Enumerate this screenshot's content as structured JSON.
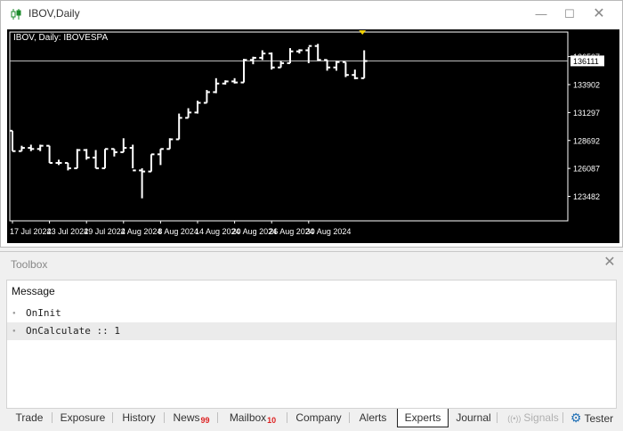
{
  "window": {
    "title": "IBOV,Daily",
    "minimize_glyph": "—",
    "maximize_glyph": "☐",
    "close_glyph": "✕"
  },
  "chart_data": {
    "type": "ohlc",
    "symbol_label": "IBOV, Daily: IBOVESPA",
    "current_price": 136111,
    "current_price_label": "136111",
    "y_tick_labels": [
      "136507",
      "133902",
      "131297",
      "128692",
      "126087",
      "123482"
    ],
    "y_ticks": [
      136507,
      133902,
      131297,
      128692,
      126087,
      123482
    ],
    "ylim": [
      121200,
      138800
    ],
    "x_tick_labels": [
      "17 Jul 2024",
      "23 Jul 2024",
      "29 Jul 2024",
      "2 Aug 2024",
      "8 Aug 2024",
      "14 Aug 2024",
      "20 Aug 2024",
      "26 Aug 2024",
      "30 Aug 2024"
    ],
    "x_tick_bar_index": [
      0,
      4,
      8,
      12,
      16,
      20,
      24,
      28,
      32
    ],
    "bars": [
      {
        "o": 129600,
        "h": 129600,
        "l": 127700,
        "c": 127700
      },
      {
        "o": 127700,
        "h": 128200,
        "l": 127700,
        "c": 128000
      },
      {
        "o": 128000,
        "h": 128300,
        "l": 127700,
        "c": 127900
      },
      {
        "o": 127900,
        "h": 128300,
        "l": 127700,
        "c": 128200
      },
      {
        "o": 128200,
        "h": 128200,
        "l": 126600,
        "c": 126600
      },
      {
        "o": 126600,
        "h": 126900,
        "l": 126400,
        "c": 126600
      },
      {
        "o": 126600,
        "h": 126600,
        "l": 125900,
        "c": 126100
      },
      {
        "o": 126100,
        "h": 127900,
        "l": 126100,
        "c": 127800
      },
      {
        "o": 127800,
        "h": 127900,
        "l": 126900,
        "c": 127100
      },
      {
        "o": 127100,
        "h": 127800,
        "l": 126100,
        "c": 126100
      },
      {
        "o": 126100,
        "h": 127900,
        "l": 126100,
        "c": 127900
      },
      {
        "o": 127900,
        "h": 127900,
        "l": 127200,
        "c": 127600
      },
      {
        "o": 127600,
        "h": 128900,
        "l": 127600,
        "c": 128000
      },
      {
        "o": 128000,
        "h": 128300,
        "l": 126100,
        "c": 125900
      },
      {
        "o": 125900,
        "h": 126100,
        "l": 123300,
        "c": 125800
      },
      {
        "o": 125800,
        "h": 127400,
        "l": 125800,
        "c": 127400
      },
      {
        "o": 127400,
        "h": 127900,
        "l": 126400,
        "c": 127900
      },
      {
        "o": 127900,
        "h": 128900,
        "l": 127900,
        "c": 128800
      },
      {
        "o": 128800,
        "h": 131200,
        "l": 128800,
        "c": 130800
      },
      {
        "o": 130800,
        "h": 131700,
        "l": 130800,
        "c": 131300
      },
      {
        "o": 131300,
        "h": 132400,
        "l": 131200,
        "c": 132200
      },
      {
        "o": 132200,
        "h": 133400,
        "l": 132200,
        "c": 133200
      },
      {
        "o": 133200,
        "h": 134500,
        "l": 133100,
        "c": 134000
      },
      {
        "o": 134000,
        "h": 134300,
        "l": 133900,
        "c": 134200
      },
      {
        "o": 134200,
        "h": 134500,
        "l": 134000,
        "c": 134100
      },
      {
        "o": 134100,
        "h": 136300,
        "l": 134100,
        "c": 136200
      },
      {
        "o": 136200,
        "h": 136500,
        "l": 135800,
        "c": 136400
      },
      {
        "o": 136400,
        "h": 137100,
        "l": 136200,
        "c": 136800
      },
      {
        "o": 136800,
        "h": 136900,
        "l": 135300,
        "c": 135500
      },
      {
        "o": 135500,
        "h": 136100,
        "l": 135500,
        "c": 135900
      },
      {
        "o": 135900,
        "h": 137300,
        "l": 135900,
        "c": 137000
      },
      {
        "o": 137000,
        "h": 137200,
        "l": 136800,
        "c": 137100
      },
      {
        "o": 137100,
        "h": 137400,
        "l": 135900,
        "c": 137500
      },
      {
        "o": 137500,
        "h": 137700,
        "l": 136100,
        "c": 136200
      },
      {
        "o": 136200,
        "h": 136200,
        "l": 135200,
        "c": 135500
      },
      {
        "o": 135500,
        "h": 136100,
        "l": 135200,
        "c": 136000
      },
      {
        "o": 136000,
        "h": 136000,
        "l": 134600,
        "c": 134800
      },
      {
        "o": 134800,
        "h": 135300,
        "l": 134400,
        "c": 134500
      },
      {
        "o": 134500,
        "h": 137100,
        "l": 134500,
        "c": 136100
      }
    ],
    "colors": {
      "background": "#000000",
      "bar": "#ffffff",
      "price_line": "#c8c8c8",
      "axis": "#ffffff",
      "marker": "#f2d200"
    }
  },
  "toolbox": {
    "title": "Toolbox",
    "close_glyph": "✕",
    "message_header": "Message",
    "bullet": "●",
    "messages": [
      {
        "text": "OnInit",
        "selected": false
      },
      {
        "text": "OnCalculate :: 1",
        "selected": true
      }
    ],
    "tabs": [
      {
        "label": "Trade"
      },
      {
        "label": "Exposure"
      },
      {
        "label": "History"
      },
      {
        "label": "News",
        "badge": "99"
      },
      {
        "label": "Mailbox",
        "badge": "10"
      },
      {
        "label": "Company"
      },
      {
        "label": "Alerts"
      },
      {
        "label": "Experts",
        "active": true
      },
      {
        "label": "Journal"
      },
      {
        "label": "Signals",
        "disabled": true,
        "icon": "signal-broadcast-icon"
      },
      {
        "label": "Tester",
        "icon": "gear-tester-icon"
      }
    ]
  }
}
